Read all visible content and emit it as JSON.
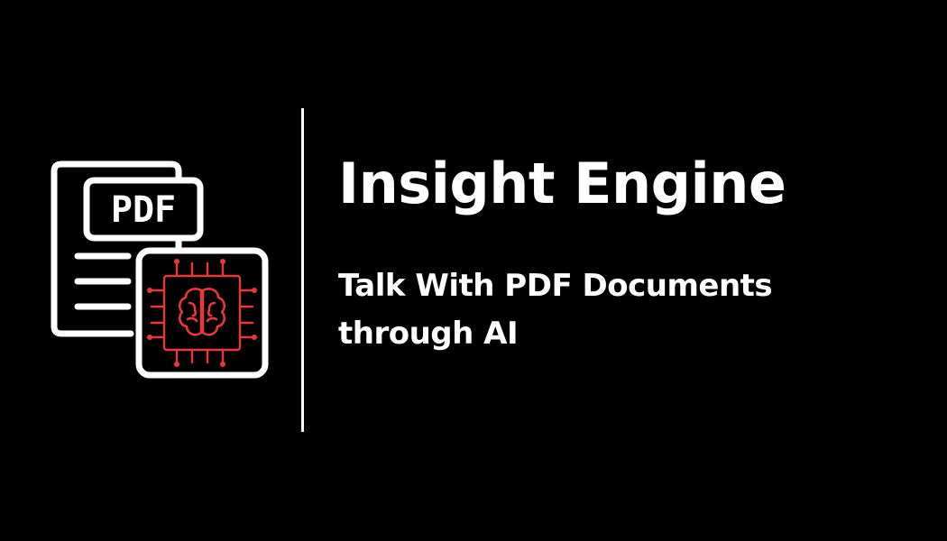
{
  "logo": {
    "icon": "pdf-document-with-ai-chip-icon",
    "badge_text": "PDF",
    "colors": {
      "outline": "#ffffff",
      "chip": "#e8383d",
      "background": "#000000"
    }
  },
  "title": "Insight Engine",
  "subtitle": {
    "line1": "Talk With PDF Documents",
    "line2": "through AI"
  }
}
